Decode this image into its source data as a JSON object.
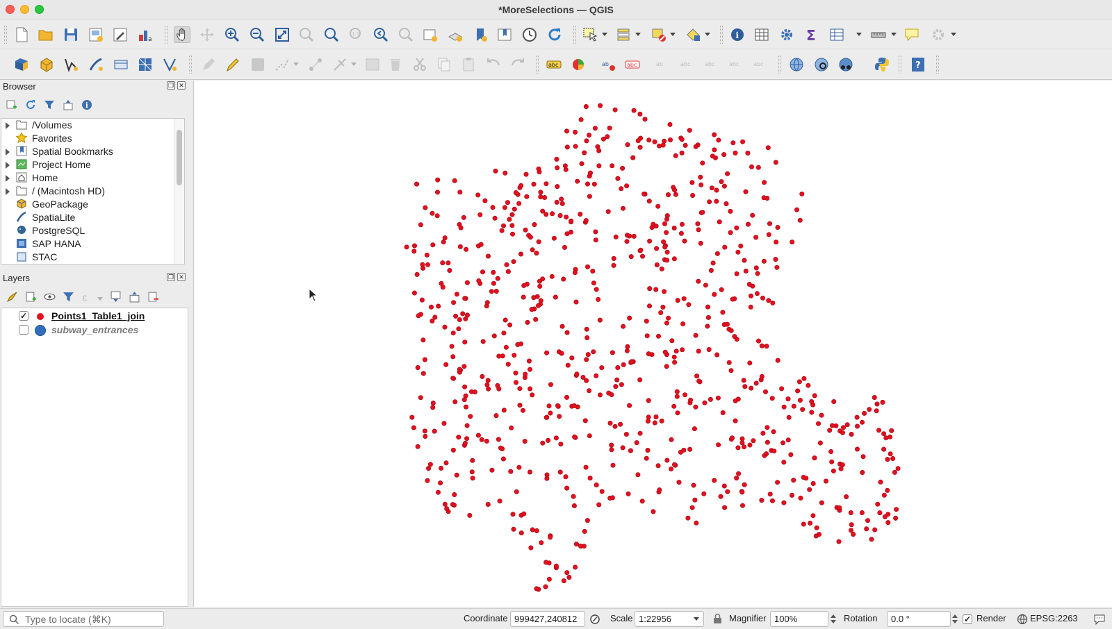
{
  "window": {
    "title": "*MoreSelections — QGIS"
  },
  "browser": {
    "title": "Browser",
    "items": [
      {
        "label": "/Volumes",
        "icon": "folder-icon",
        "expandable": true
      },
      {
        "label": "Favorites",
        "icon": "star-icon",
        "expandable": false
      },
      {
        "label": "Spatial Bookmarks",
        "icon": "bookmark-icon",
        "expandable": true
      },
      {
        "label": "Project Home",
        "icon": "project-home-icon",
        "expandable": true
      },
      {
        "label": "Home",
        "icon": "home-icon",
        "expandable": true
      },
      {
        "label": "/ (Macintosh HD)",
        "icon": "folder-icon",
        "expandable": true
      },
      {
        "label": "GeoPackage",
        "icon": "geopackage-icon",
        "expandable": false
      },
      {
        "label": "SpatiaLite",
        "icon": "spatialite-icon",
        "expandable": false
      },
      {
        "label": "PostgreSQL",
        "icon": "postgresql-icon",
        "expandable": false
      },
      {
        "label": "SAP HANA",
        "icon": "sap-hana-icon",
        "expandable": false
      },
      {
        "label": "STAC",
        "icon": "stac-icon",
        "expandable": false
      }
    ]
  },
  "layers": {
    "title": "Layers",
    "items": [
      {
        "name": "Points1_Table1_join",
        "visible": true,
        "symbol_color": "#e3101e",
        "style": "bold-underline"
      },
      {
        "name": "subway_entrances",
        "visible": false,
        "symbol_color": "#2f6fbd",
        "style": "bold-italic-gray"
      }
    ]
  },
  "map": {
    "point_color": "#e3101e",
    "background": "#ffffff"
  },
  "status": {
    "locate_placeholder": "Type to locate (⌘K)",
    "coordinate_label": "Coordinate",
    "coordinate_value": "999427,240812",
    "scale_label": "Scale",
    "scale_value": "1:22956",
    "magnifier_label": "Magnifier",
    "magnifier_value": "100%",
    "rotation_label": "Rotation",
    "rotation_value": "0.0 °",
    "render_label": "Render",
    "render_checked": true,
    "crs_label": "EPSG:2263"
  }
}
